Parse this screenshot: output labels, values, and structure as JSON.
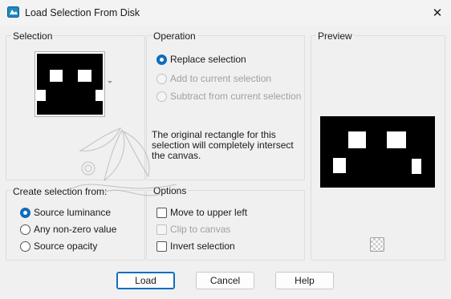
{
  "window": {
    "title": "Load Selection From Disk",
    "close_glyph": "✕"
  },
  "selection": {
    "title": "Selection"
  },
  "operation": {
    "title": "Operation",
    "options": [
      "Replace selection",
      "Add to current selection",
      "Subtract from current selection"
    ],
    "selected_index": 0,
    "disabled_indices": [
      1,
      2
    ],
    "info": "The original rectangle for this selection will completely intersect the canvas."
  },
  "preview": {
    "title": "Preview",
    "checker_icon": "transparency-checker-icon"
  },
  "create_from": {
    "title": "Create selection from:",
    "options": [
      "Source luminance",
      "Any non-zero value",
      "Source opacity"
    ],
    "selected_index": 0
  },
  "options": {
    "title": "Options",
    "items": [
      {
        "label": "Move to upper left",
        "checked": false,
        "disabled": false
      },
      {
        "label": "Clip to canvas",
        "checked": false,
        "disabled": true
      },
      {
        "label": "Invert selection",
        "checked": false,
        "disabled": false
      }
    ]
  },
  "buttons": {
    "load": "Load",
    "cancel": "Cancel",
    "help": "Help"
  },
  "colors": {
    "accent": "#0f6cbd",
    "background": "#f0f0f0"
  }
}
